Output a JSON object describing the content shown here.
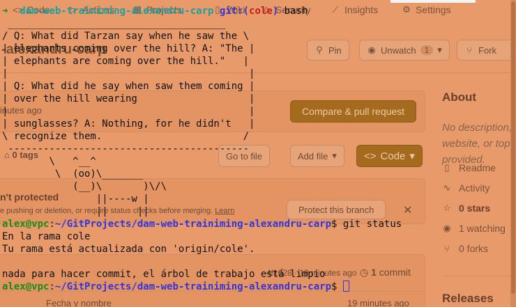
{
  "github": {
    "nav": {
      "code": "Code",
      "actions": "Actions",
      "projects": "Projects",
      "wiki": "Wiki",
      "security": "Security",
      "insights": "Insights",
      "settings": "Settings"
    },
    "repo_name_fragment": "-alexandru-carp",
    "pin_label": "Pin",
    "unwatch_label": "Unwatch",
    "unwatch_count": "1",
    "fork_label": "Fork",
    "compare_button": "Compare & pull request",
    "pushed_time": "inutes ago",
    "tags_label": "0 tags",
    "go_to_file": "Go to file",
    "add_file": "Add file",
    "code_button": "Code",
    "protect_title": "n't protected",
    "protect_text": "e pushing or deletion, or require status checks before merging.",
    "protect_learn": "Learn",
    "protect_button": "Protect this branch",
    "commit_count": "1",
    "commit_label": "commit",
    "commit_hash": "4f1628",
    "commit_time": "19 minutes ago",
    "file_header": "Fecha y nombre",
    "file_time": "19 minutes ago",
    "about": {
      "title": "About",
      "description": "No description, website, or topics provided.",
      "readme": "Readme",
      "activity": "Activity",
      "stars": "0 stars",
      "watching": "1 watching",
      "forks": "0 forks"
    },
    "releases_title": "Releases"
  },
  "terminal": {
    "prompt_user": "alex@vpc",
    "prompt_path": "~/GitProjects/dam-web-trainiming-alexandru-carp",
    "header_path": "dam-web-trainiming-alexandru-carp",
    "git_label": "git:(",
    "branch": "cole",
    "git_close": ")",
    "header_cmd": "bash",
    "fortune_lines": [
      " _____________________________________",
      "/ Q: What did Tarzan say when he saw the \\",
      "| elephants coming over the hill? A: \"The |",
      "| elephants are coming over the hill.\"   |",
      "|                                         |",
      "| Q: What did he say when saw them coming |",
      "| over the hill wearing                   |",
      "|                                         |",
      "| sunglasses? A: Nothing, for he didn't   |",
      "\\ recognize them.                        /",
      " -----------------------------------------",
      "        \\   ^__^",
      "         \\  (oo)\\_______",
      "            (__)\\       )\\/\\",
      "                ||----w |",
      "                ||     ||"
    ],
    "command": "git status",
    "output": [
      "En la rama cole",
      "Tu rama está actualizada con 'origin/cole'.",
      "",
      "nada para hacer commit, el árbol de trabajo está limpio"
    ]
  }
}
